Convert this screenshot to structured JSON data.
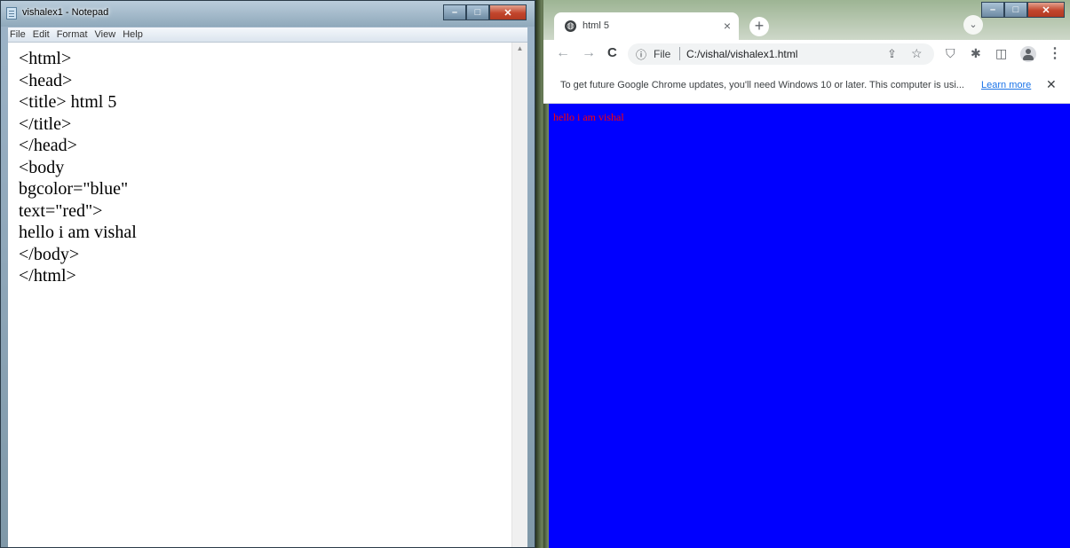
{
  "notepad": {
    "title": "vishalex1 - Notepad",
    "menu": [
      "File",
      "Edit",
      "Format",
      "View",
      "Help"
    ],
    "content": "<html>\n<head>\n<title> html 5\n</title>\n</head>\n<body\nbgcolor=\"blue\"\ntext=\"red\">\nhello i am vishal\n</body>\n</html>",
    "window_buttons": {
      "minimize": "–",
      "maximize": "□",
      "close": "✕"
    }
  },
  "chrome": {
    "tab": {
      "title": "html 5",
      "close": "×"
    },
    "new_tab": "+",
    "tab_search": "⌄",
    "window_buttons": {
      "minimize": "–",
      "maximize": "□",
      "close": "✕"
    },
    "nav": {
      "back": "←",
      "forward": "→",
      "reload": "C"
    },
    "omnibox": {
      "info": "ⓘ",
      "scheme": "File",
      "url": "C:/vishal/vishalex1.html"
    },
    "infobar": {
      "message": "To get future Google Chrome updates, you'll need Windows 10 or later. This computer is usi...",
      "link": "Learn more",
      "close": "✕"
    },
    "page": {
      "text": "hello i am vishal",
      "bgcolor": "#0000ff",
      "textcolor": "#ff0000"
    }
  }
}
